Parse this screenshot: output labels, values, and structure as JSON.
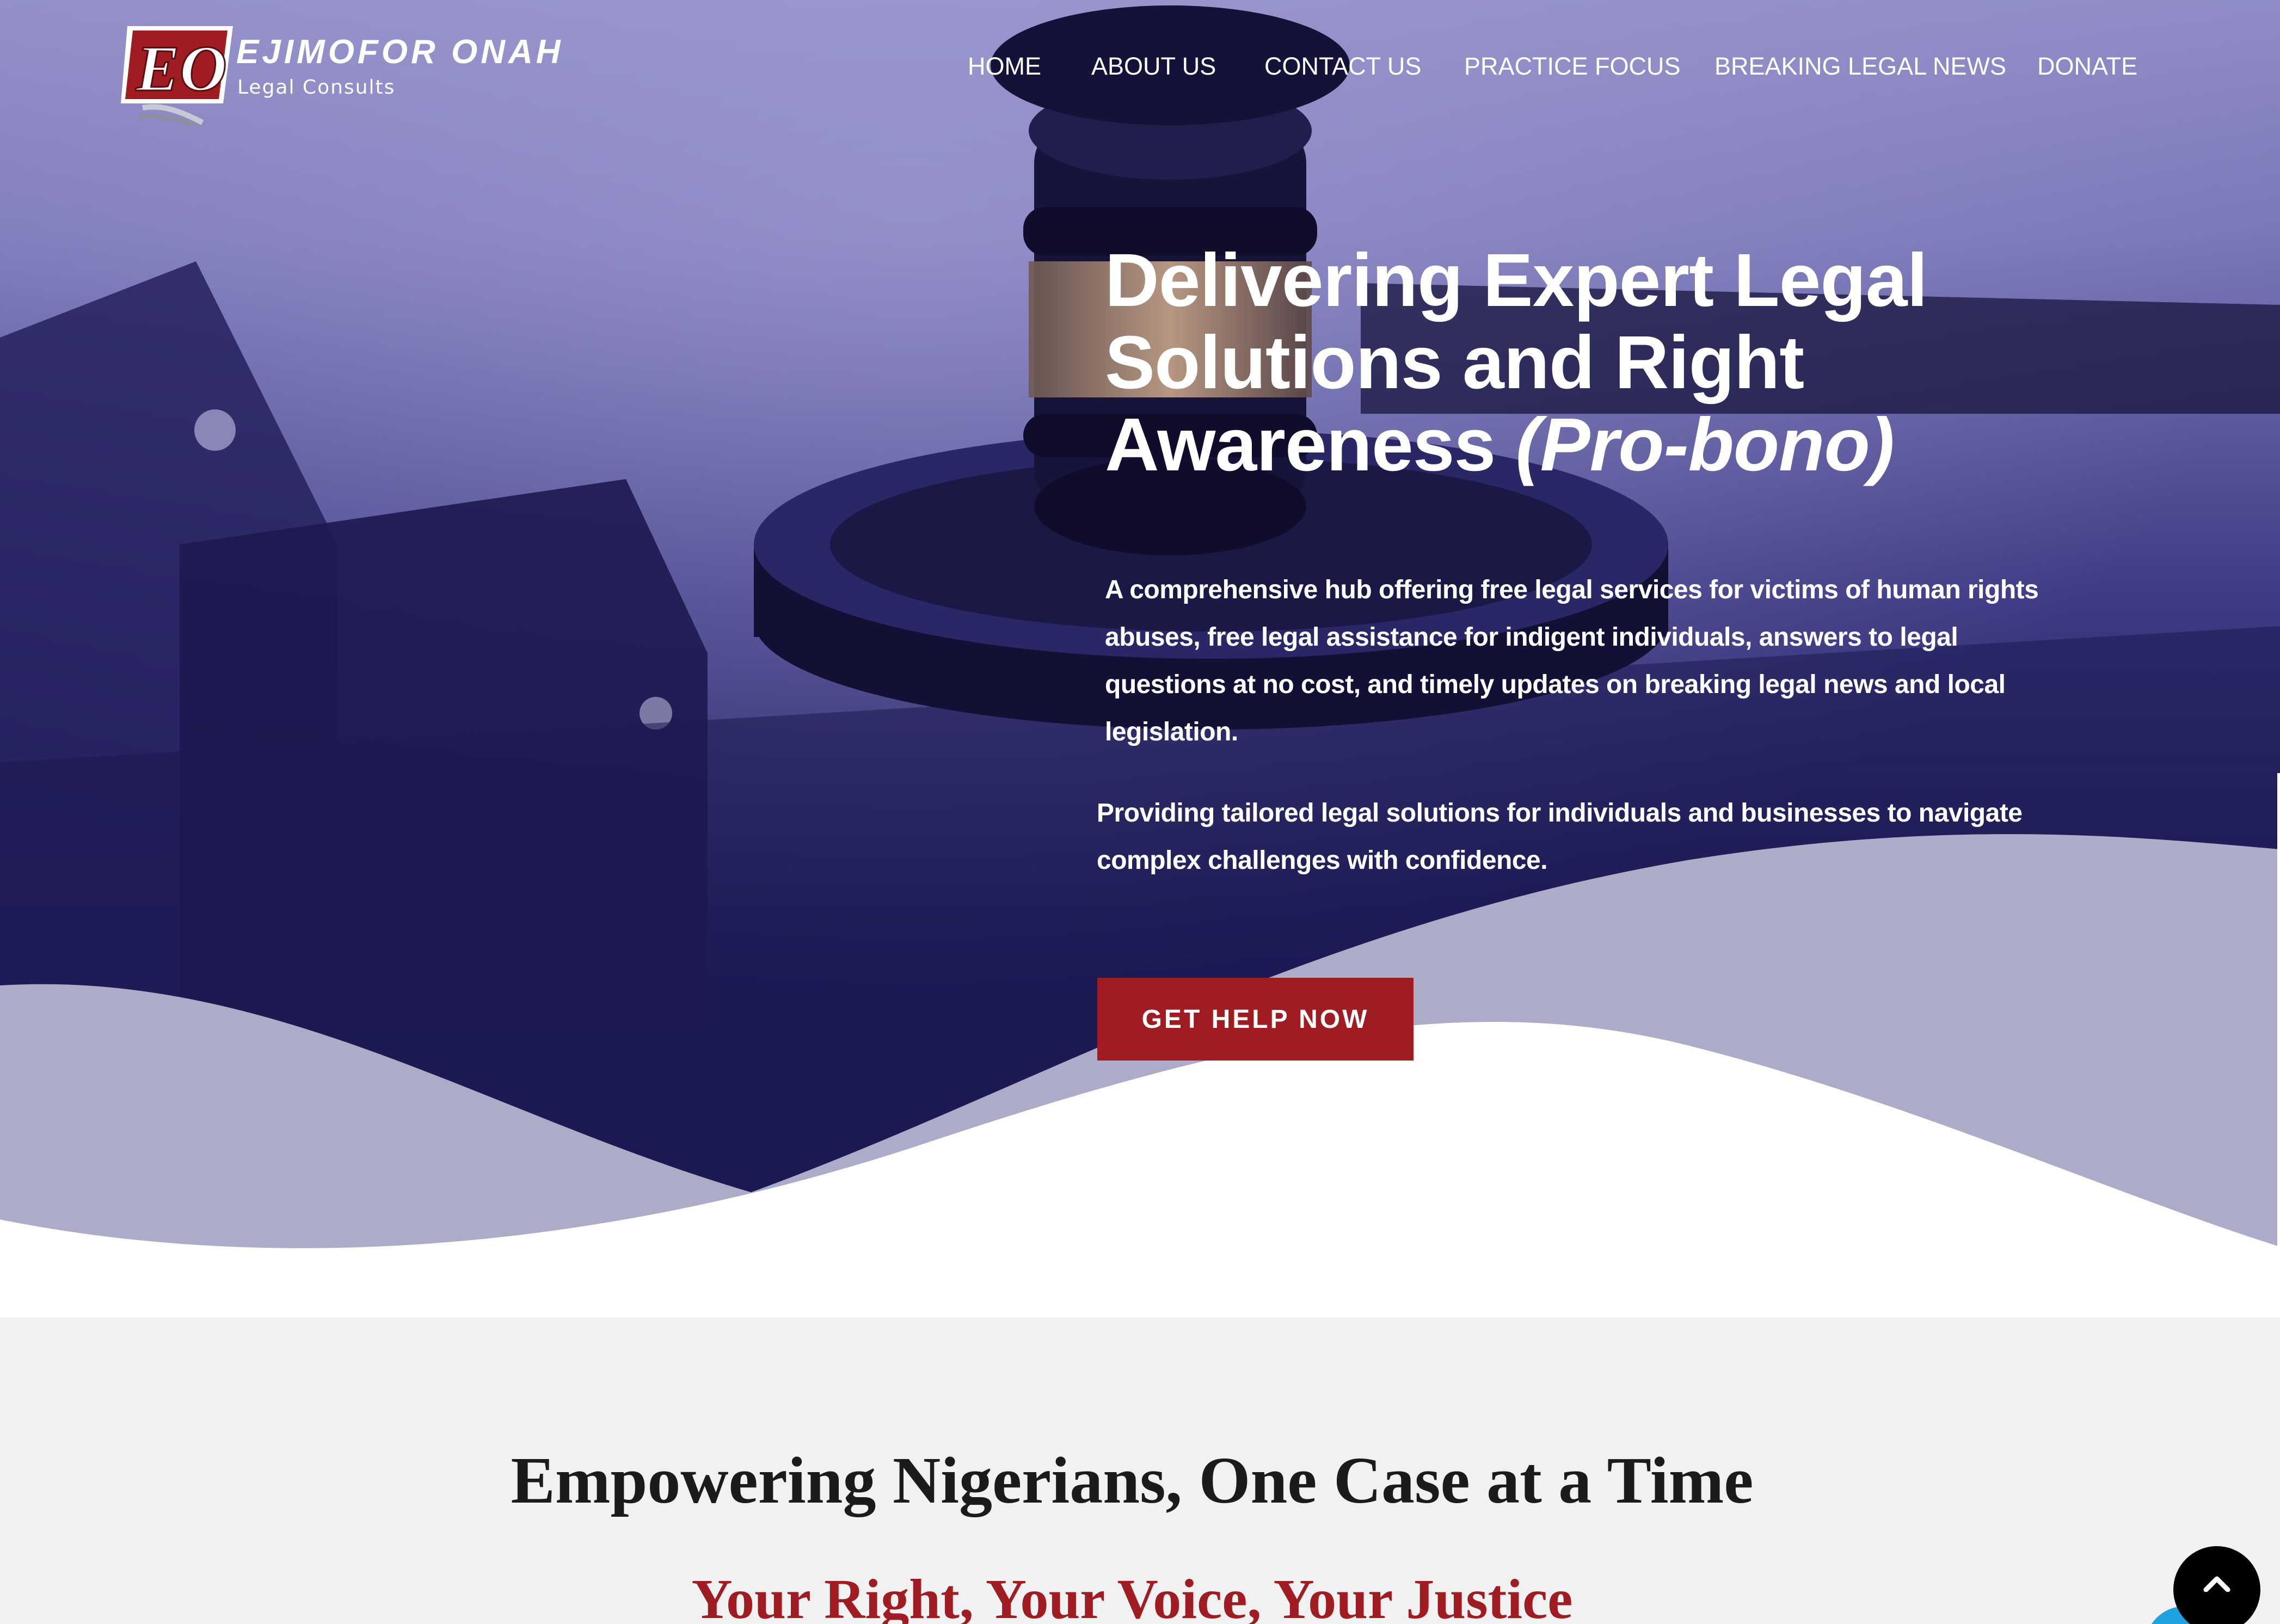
{
  "brand": {
    "mark": "EO",
    "name": "EJIMOFOR ONAH",
    "tagline": "Legal Consults",
    "colors": {
      "primary_red": "#9e1c22",
      "hero_navy": "#1f1d5a",
      "hero_lavender": "#8f8cc6"
    }
  },
  "nav": {
    "items": [
      {
        "label": "HOME"
      },
      {
        "label": "ABOUT US"
      },
      {
        "label": "CONTACT US"
      },
      {
        "label": "PRACTICE FOCUS"
      },
      {
        "label": "BREAKING LEGAL NEWS"
      },
      {
        "label": "DONATE"
      }
    ]
  },
  "hero": {
    "title_line1": "Delivering Expert Legal",
    "title_line2": "Solutions and Right",
    "title_line3": "Awareness",
    "title_emphasis": "(Pro-bono)",
    "description": "A comprehensive hub offering free legal services for victims of human rights abuses, free legal assistance for indigent individuals, answers to legal questions at no cost, and timely updates on breaking legal news and local legislation.",
    "description2": "Providing tailored legal solutions for individuals and businesses to navigate complex challenges with confidence.",
    "cta_label": "GET HELP NOW",
    "background_image": "gavel-on-sound-block"
  },
  "section": {
    "title": "Empowering Nigerians, One Case at a Time",
    "subtitle": "Your Right, Your Voice, Your Justice"
  },
  "widgets": {
    "scroll_top_icon": "chevron-up-icon",
    "chat_icon": "chat-bubble-icon"
  }
}
